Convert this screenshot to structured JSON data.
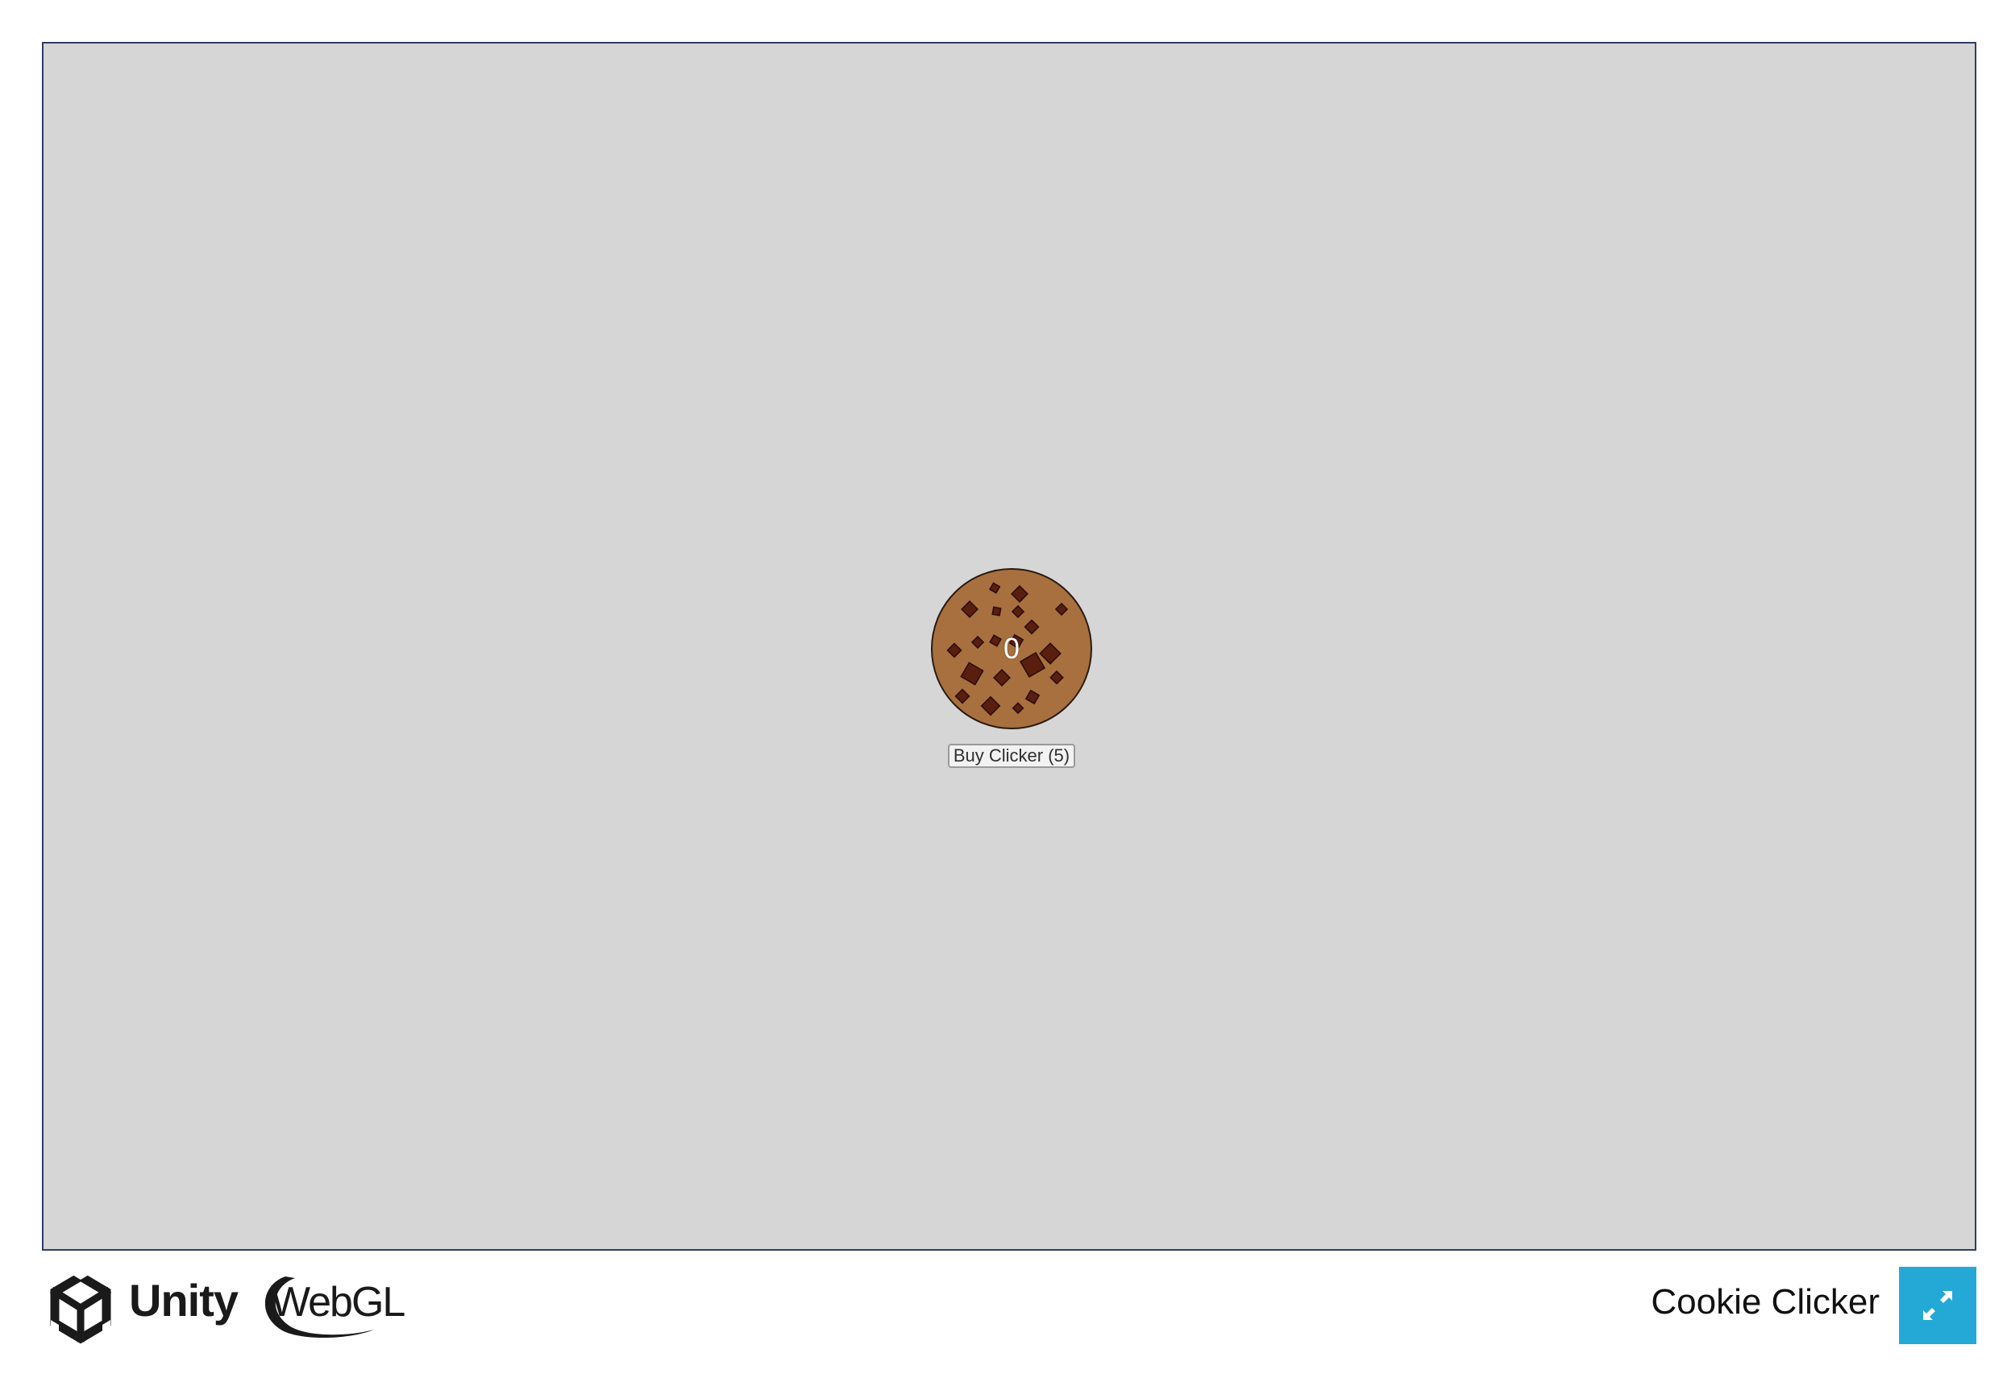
{
  "game": {
    "cookie_count": "0",
    "buy_button_label": "Buy Clicker (5)"
  },
  "footer": {
    "unity_label": "Unity",
    "webgl_label": "WebGL",
    "title": "Cookie Clicker"
  },
  "icons": {
    "unity": "unity-logo-icon",
    "webgl": "webgl-logo-icon",
    "fullscreen": "fullscreen-icon"
  },
  "colors": {
    "canvas_bg": "#d6d6d6",
    "canvas_border": "#2d3e63",
    "cookie_dough": "#a8703e",
    "chocolate_chip": "#5a1e0e",
    "fullscreen_button": "#24a9d6"
  }
}
